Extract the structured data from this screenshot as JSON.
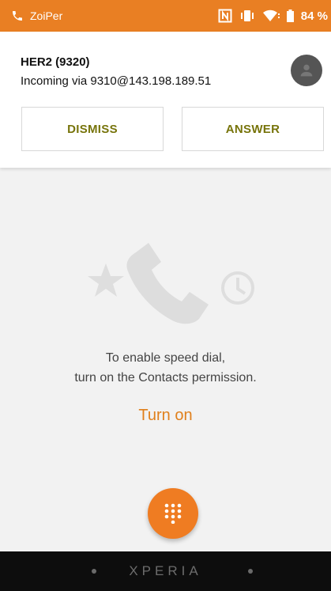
{
  "status_bar": {
    "app_name": "ZoiPer",
    "battery": "84 %",
    "icons": [
      "phone-icon",
      "nfc-icon",
      "vibrate-icon",
      "wifi-icon",
      "battery-icon"
    ]
  },
  "notification": {
    "caller": "HER2 (9320)",
    "via": "Incoming via 9310@143.198.189.51",
    "dismiss_label": "DISMISS",
    "answer_label": "ANSWER",
    "avatar_icon": "person-icon"
  },
  "speed_dial": {
    "line1": "To enable speed dial,",
    "line2": "turn on the Contacts permission.",
    "turn_on_label": "Turn on"
  },
  "fab": {
    "icon": "dialpad-icon"
  },
  "bezel": {
    "brand": "XPERIA"
  },
  "colors": {
    "accent": "#e97f23",
    "action_text": "#77740b",
    "link": "#e0801c"
  }
}
